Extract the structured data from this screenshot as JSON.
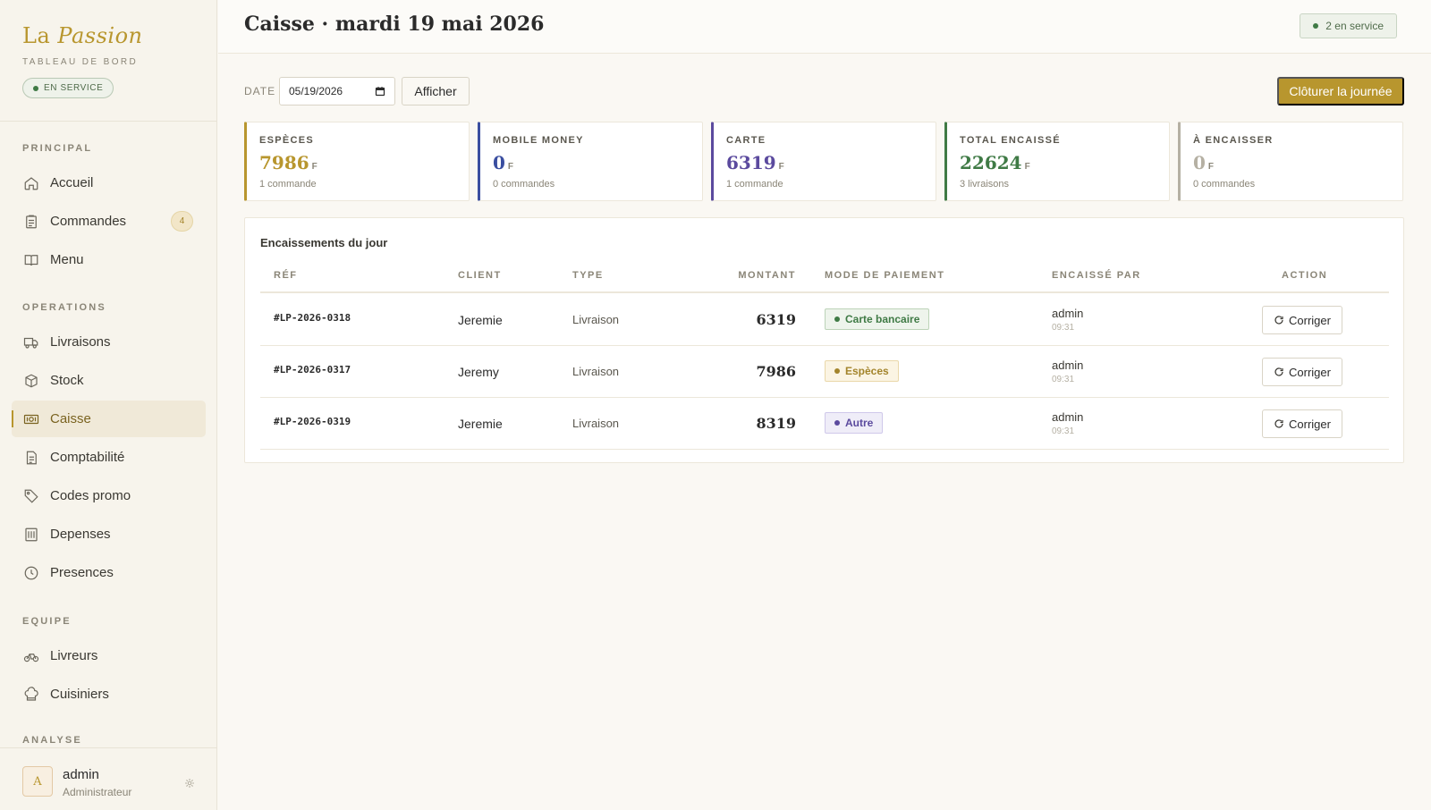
{
  "sidebar": {
    "brand_prefix": "La",
    "brand_main": "Passion",
    "subtitle": "TABLEAU DE BORD",
    "status": "EN SERVICE",
    "sections": {
      "principal": "PRINCIPAL",
      "operations": "OPERATIONS",
      "equipe": "EQUIPE",
      "analyse": "ANALYSE"
    },
    "items": {
      "accueil": "Accueil",
      "commandes": "Commandes",
      "commandes_badge": "4",
      "menu": "Menu",
      "livraisons": "Livraisons",
      "stock": "Stock",
      "caisse": "Caisse",
      "comptabilite": "Comptabilité",
      "codes_promo": "Codes promo",
      "depenses": "Depenses",
      "presences": "Presences",
      "livreurs": "Livreurs",
      "cuisiniers": "Cuisiniers"
    },
    "user": {
      "initial": "A",
      "name": "admin",
      "role": "Administrateur"
    }
  },
  "header": {
    "title": "Caisse · mardi 19 mai 2026",
    "service_pill": "2 en service"
  },
  "toolbar": {
    "date_label": "DATE",
    "date_value": "05/19/2026",
    "show_button": "Afficher",
    "close_day_button": "Clôturer la journée"
  },
  "cards": [
    {
      "label": "ESPÈCES",
      "value": "7986",
      "unit": "F",
      "sub": "1 commande",
      "color": "#b8962e"
    },
    {
      "label": "MOBILE MONEY",
      "value": "0",
      "unit": "F",
      "sub": "0 commandes",
      "color": "#3a4ea0"
    },
    {
      "label": "CARTE",
      "value": "6319",
      "unit": "F",
      "sub": "1 commande",
      "color": "#5b4a9e"
    },
    {
      "label": "TOTAL ENCAISSÉ",
      "value": "22624",
      "unit": "F",
      "sub": "3 livraisons",
      "color": "#3f7a45"
    },
    {
      "label": "À ENCAISSER",
      "value": "0",
      "unit": "F",
      "sub": "0 commandes",
      "color": "#b5b0a3"
    }
  ],
  "table": {
    "title": "Encaissements du jour",
    "columns": {
      "ref": "RÉF",
      "client": "CLIENT",
      "type": "TYPE",
      "amount": "MONTANT",
      "payment": "MODE DE PAIEMENT",
      "by": "ENCAISSÉ PAR",
      "action": "ACTION"
    },
    "rows": [
      {
        "ref": "#LP-2026-0318",
        "client": "Jeremie",
        "type": "Livraison",
        "amount": "6319",
        "payment": "Carte bancaire",
        "pay_fg": "#3f7a45",
        "pay_bg": "#eef4ec",
        "pay_border": "#bcd3b8",
        "by": "admin",
        "time": "09:31",
        "action": "Corriger"
      },
      {
        "ref": "#LP-2026-0317",
        "client": "Jeremy",
        "type": "Livraison",
        "amount": "7986",
        "payment": "Espèces",
        "pay_fg": "#a3842b",
        "pay_bg": "#fbf4e3",
        "pay_border": "#ead8aa",
        "by": "admin",
        "time": "09:31",
        "action": "Corriger"
      },
      {
        "ref": "#LP-2026-0319",
        "client": "Jeremie",
        "type": "Livraison",
        "amount": "8319",
        "payment": "Autre",
        "pay_fg": "#5b4a9e",
        "pay_bg": "#efedf8",
        "pay_border": "#cfc8ea",
        "by": "admin",
        "time": "09:31",
        "action": "Corriger"
      }
    ]
  }
}
